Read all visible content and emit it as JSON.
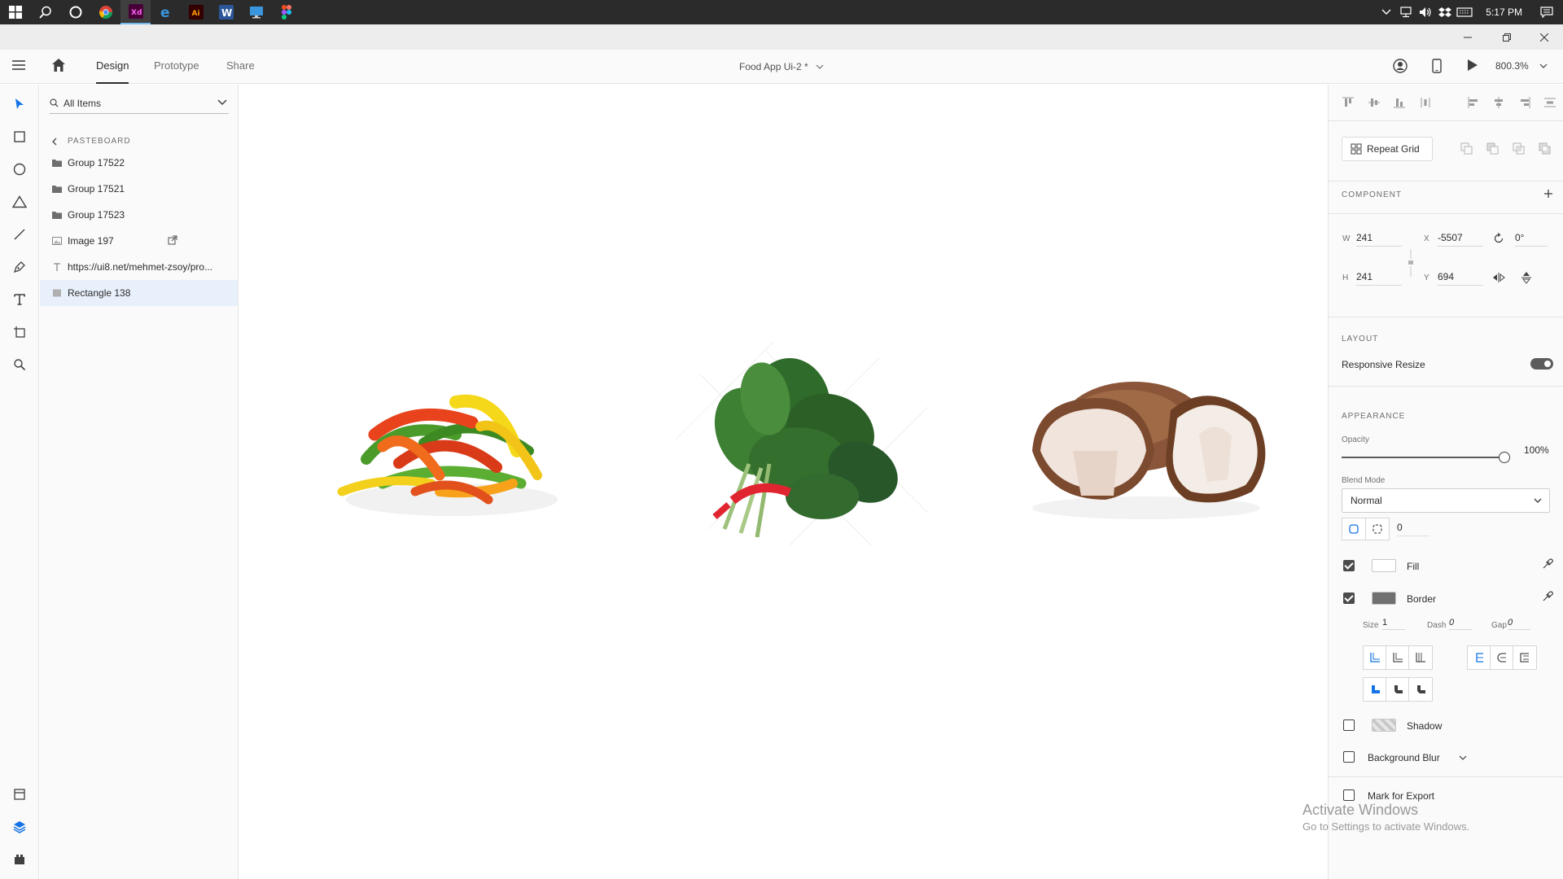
{
  "taskbar": {
    "apps": [
      "windows-logo",
      "search",
      "cortana",
      "chrome",
      "adobe-xd",
      "edge",
      "adobe-illustrator",
      "word",
      "remote-desktop",
      "figma"
    ],
    "clock": "5:17 PM"
  },
  "header": {
    "tabs": [
      {
        "label": "Design",
        "active": true
      },
      {
        "label": "Prototype",
        "active": false
      },
      {
        "label": "Share",
        "active": false
      }
    ],
    "document_title": "Food App Ui-2 *",
    "zoom": "800.3%"
  },
  "layers": {
    "filter_label": "All Items",
    "pasteboard_label": "PASTEBOARD",
    "items": [
      {
        "label": "Group 17522",
        "icon": "folder-icon",
        "selected": false
      },
      {
        "label": "Group 17521",
        "icon": "folder-icon",
        "selected": false
      },
      {
        "label": "Group 17523",
        "icon": "folder-icon",
        "selected": false
      },
      {
        "label": "Image 197",
        "icon": "image-icon",
        "selected": false
      },
      {
        "label": "https://ui8.net/mehmet-zsoy/pro...",
        "icon": "text-icon",
        "selected": false
      },
      {
        "label": "Rectangle 138",
        "icon": "rectangle-icon",
        "selected": true
      }
    ]
  },
  "canvas": {
    "images": [
      "bell-pepper-strips",
      "spinach-bunch",
      "mushrooms"
    ]
  },
  "properties": {
    "repeat_grid_label": "Repeat Grid",
    "component_title": "COMPONENT",
    "w_label": "W",
    "w_value": "241",
    "h_label": "H",
    "h_value": "241",
    "x_label": "X",
    "x_value": "-5507",
    "y_label": "Y",
    "y_value": "694",
    "rotation_value": "0°",
    "layout_title": "LAYOUT",
    "responsive_resize_label": "Responsive Resize",
    "responsive_resize_on": true,
    "appearance_title": "APPEARANCE",
    "opacity_label": "Opacity",
    "opacity_value": "100%",
    "blend_mode_label": "Blend Mode",
    "blend_mode_value": "Normal",
    "corner_radius_value": "0",
    "fill_label": "Fill",
    "fill_checked": true,
    "fill_color": "#ffffff",
    "border_label": "Border",
    "border_checked": true,
    "border_color": "#707070",
    "size_label": "Size",
    "size_value": "1",
    "dash_label": "Dash",
    "dash_value": "0",
    "gap_label": "Gap",
    "gap_value": "0",
    "shadow_label": "Shadow",
    "shadow_checked": false,
    "background_blur_label": "Background Blur",
    "background_blur_checked": false,
    "export_label": "Mark for Export",
    "export_checked": false
  },
  "watermark": {
    "title": "Activate Windows",
    "subtitle": "Go to Settings to activate Windows."
  }
}
